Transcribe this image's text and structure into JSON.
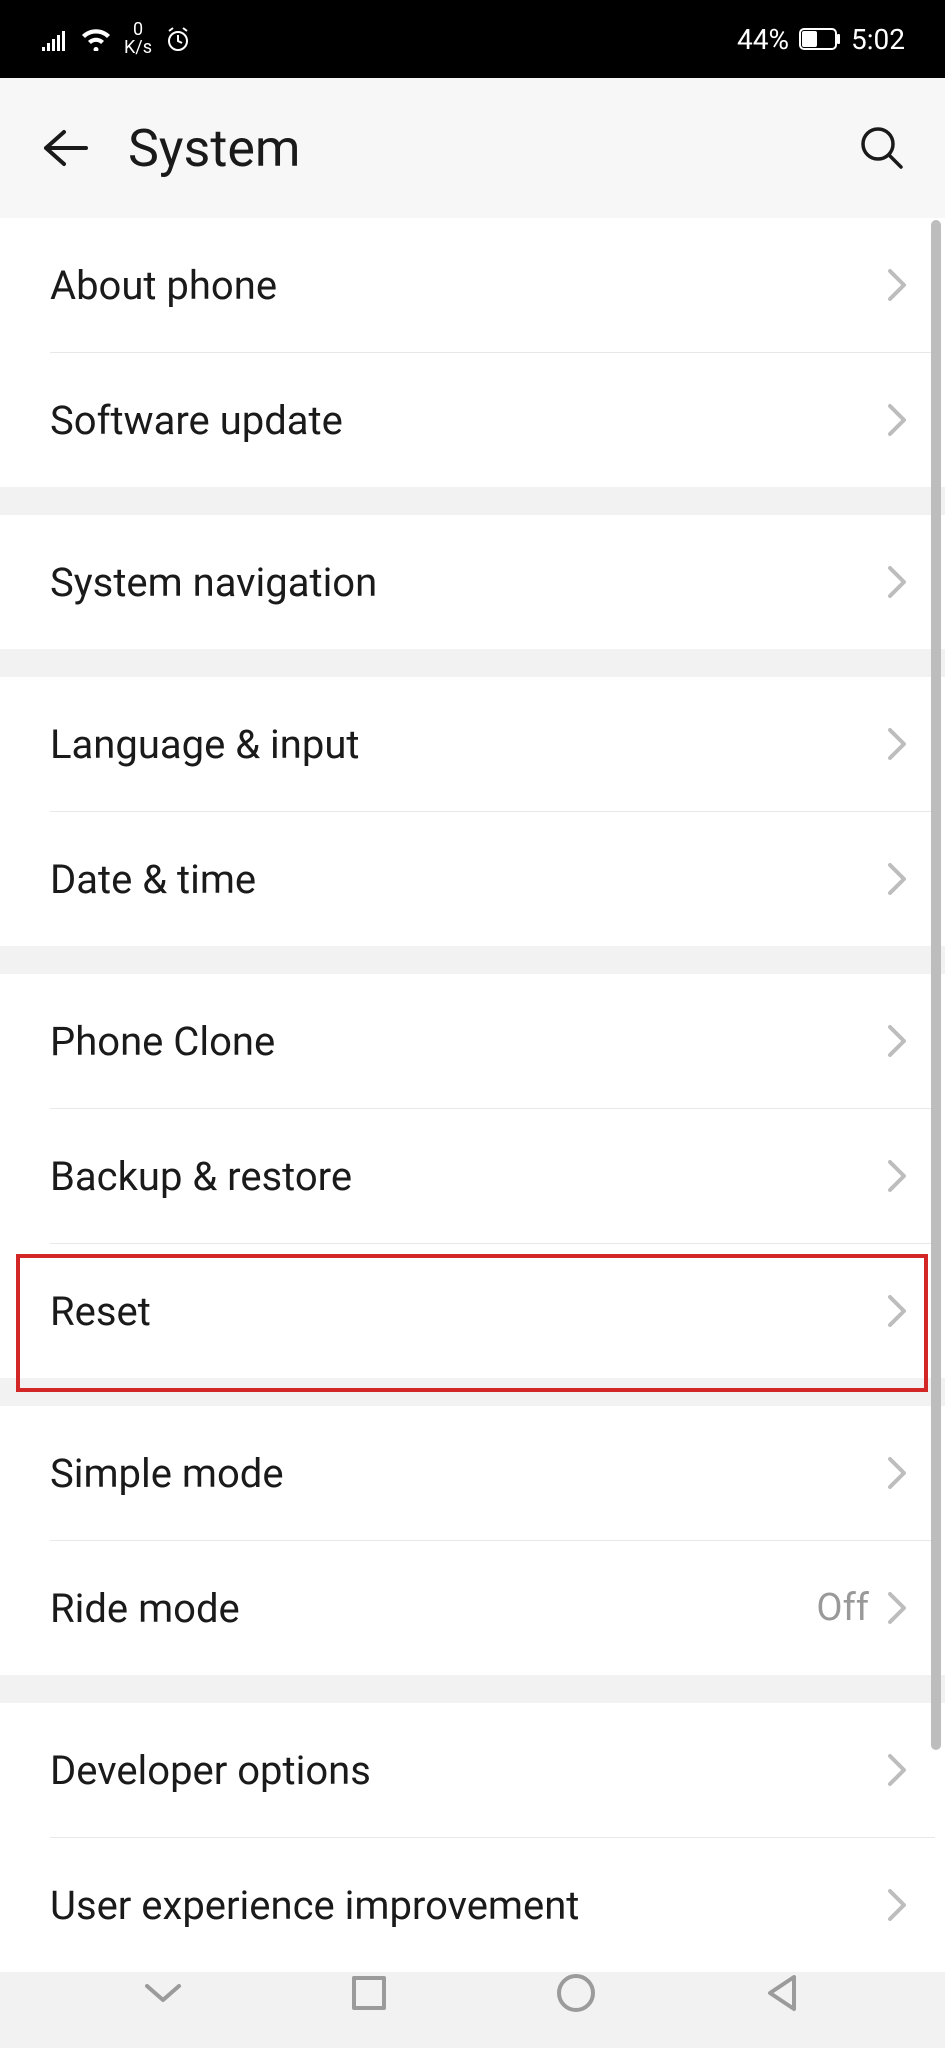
{
  "status_bar": {
    "speed_top": "0",
    "speed_bottom": "K/s",
    "battery_percent": "44%",
    "time": "5:02"
  },
  "header": {
    "title": "System"
  },
  "groups": [
    {
      "items": [
        {
          "label": "About phone",
          "value": ""
        },
        {
          "label": "Software update",
          "value": ""
        }
      ]
    },
    {
      "items": [
        {
          "label": "System navigation",
          "value": ""
        }
      ]
    },
    {
      "items": [
        {
          "label": "Language & input",
          "value": ""
        },
        {
          "label": "Date & time",
          "value": ""
        }
      ]
    },
    {
      "items": [
        {
          "label": "Phone Clone",
          "value": ""
        },
        {
          "label": "Backup & restore",
          "value": ""
        },
        {
          "label": "Reset",
          "value": ""
        }
      ]
    },
    {
      "items": [
        {
          "label": "Simple mode",
          "value": ""
        },
        {
          "label": "Ride mode",
          "value": "Off"
        }
      ]
    },
    {
      "items": [
        {
          "label": "Developer options",
          "value": ""
        },
        {
          "label": "User experience improvement",
          "value": ""
        }
      ]
    }
  ]
}
